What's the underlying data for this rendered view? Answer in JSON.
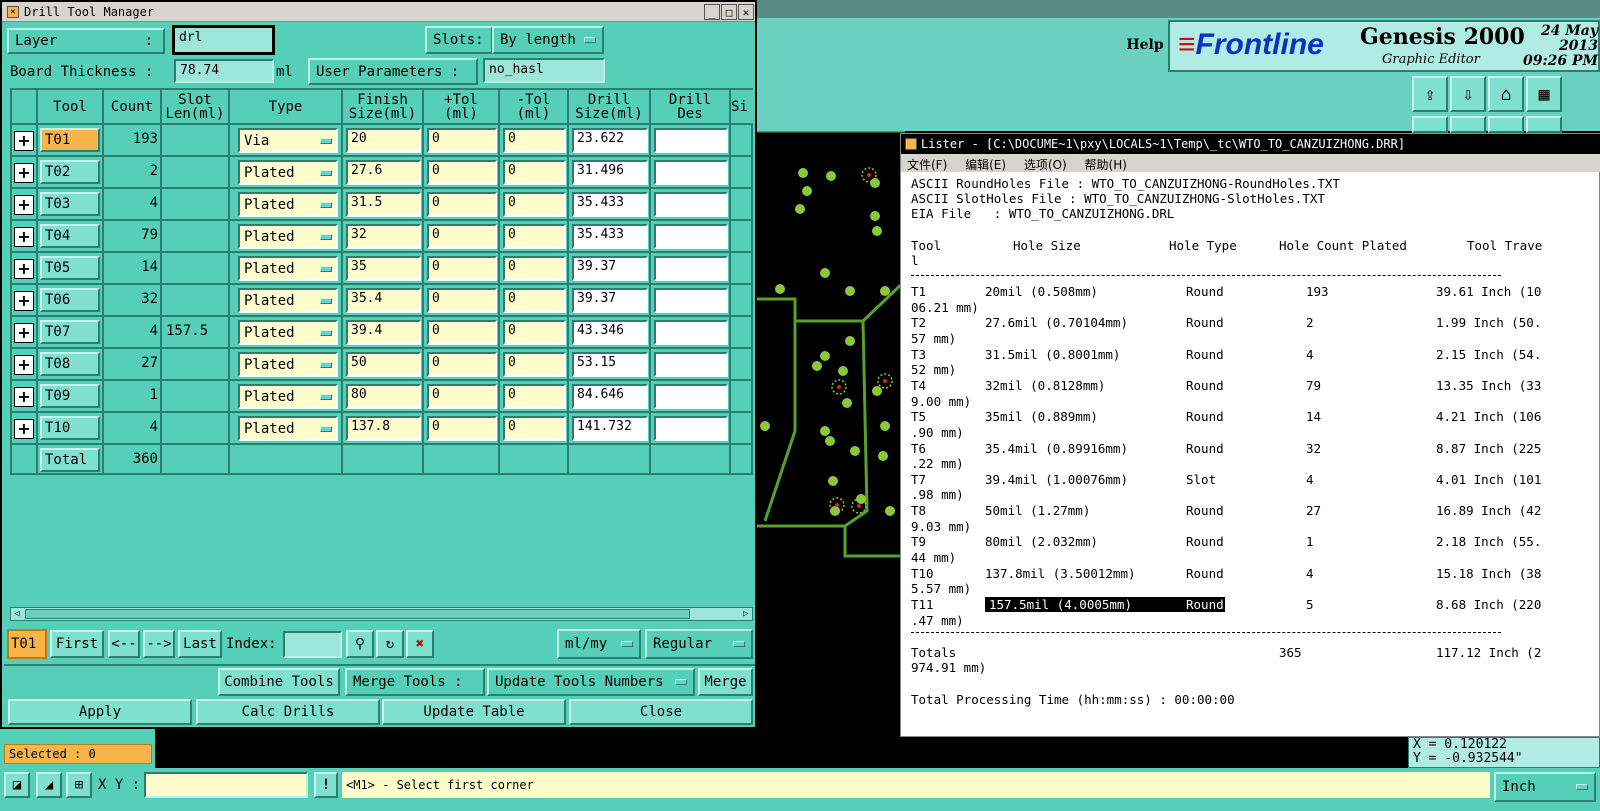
{
  "drill_window": {
    "title": "Drill Tool Manager",
    "layer_label": "Layer",
    "layer_colon": ":",
    "layer_value": "drl",
    "slots_label": "Slots:",
    "slots_value": "By length",
    "board_thickness_label": "Board Thickness :",
    "board_thickness_value": "78.74",
    "board_thickness_unit": "ml",
    "user_params_label": "User Parameters :",
    "user_params_value": "no_hasl"
  },
  "columns": [
    "Tool",
    "Count",
    "Slot\nLen(ml)",
    "Type",
    "Finish\nSize(ml)",
    "+Tol\n(ml)",
    "-Tol\n(ml)",
    "Drill\nSize(ml)",
    "Drill\nDes",
    "Si"
  ],
  "rows": [
    {
      "tool": "T01",
      "count": "193",
      "slot": "",
      "type": "Via",
      "finish": "20",
      "ptol": "0",
      "ntol": "0",
      "drill": "23.622",
      "des": ""
    },
    {
      "tool": "T02",
      "count": "2",
      "slot": "",
      "type": "Plated",
      "finish": "27.6",
      "ptol": "0",
      "ntol": "0",
      "drill": "31.496",
      "des": ""
    },
    {
      "tool": "T03",
      "count": "4",
      "slot": "",
      "type": "Plated",
      "finish": "31.5",
      "ptol": "0",
      "ntol": "0",
      "drill": "35.433",
      "des": ""
    },
    {
      "tool": "T04",
      "count": "79",
      "slot": "",
      "type": "Plated",
      "finish": "32",
      "ptol": "0",
      "ntol": "0",
      "drill": "35.433",
      "des": ""
    },
    {
      "tool": "T05",
      "count": "14",
      "slot": "",
      "type": "Plated",
      "finish": "35",
      "ptol": "0",
      "ntol": "0",
      "drill": "39.37",
      "des": ""
    },
    {
      "tool": "T06",
      "count": "32",
      "slot": "",
      "type": "Plated",
      "finish": "35.4",
      "ptol": "0",
      "ntol": "0",
      "drill": "39.37",
      "des": ""
    },
    {
      "tool": "T07",
      "count": "4",
      "slot": "157.5",
      "type": "Plated",
      "finish": "39.4",
      "ptol": "0",
      "ntol": "0",
      "drill": "43.346",
      "des": ""
    },
    {
      "tool": "T08",
      "count": "27",
      "slot": "",
      "type": "Plated",
      "finish": "50",
      "ptol": "0",
      "ntol": "0",
      "drill": "53.15",
      "des": ""
    },
    {
      "tool": "T09",
      "count": "1",
      "slot": "",
      "type": "Plated",
      "finish": "80",
      "ptol": "0",
      "ntol": "0",
      "drill": "84.646",
      "des": ""
    },
    {
      "tool": "T10",
      "count": "4",
      "slot": "",
      "type": "Plated",
      "finish": "137.8",
      "ptol": "0",
      "ntol": "0",
      "drill": "141.732",
      "des": ""
    }
  ],
  "total": {
    "label": "Total",
    "count": "360"
  },
  "nav": {
    "current": "T01",
    "first": "First",
    "prev": "<--",
    "next": "-->",
    "last": "Last",
    "index_label": "Index:",
    "index_value": "",
    "units": "ml/my",
    "mode": "Regular"
  },
  "actions": {
    "combine": "Combine Tools",
    "merge_label": "Merge Tools :",
    "merge_option": "Update Tools Numbers",
    "merge": "Merge",
    "apply": "Apply",
    "calc": "Calc Drills",
    "update": "Update Table",
    "close": "Close"
  },
  "status": {
    "selected": "Selected : 0",
    "xy_label": "X Y :",
    "prompt": "<M1> - Select first corner",
    "units": "Inch",
    "coord_x": "X = 0.120122",
    "coord_y": "Y = -0.932544\""
  },
  "app": {
    "help": "Help",
    "brand": "Frontline",
    "product": "Genesis 2000",
    "subtitle": "Graphic Editor",
    "date": "24 May 2013",
    "time": "09:26 PM"
  },
  "lister": {
    "title": "Lister - [C:\\DOCUME~1\\pxy\\LOCALS~1\\Temp\\_tc\\WTO_TO_CANZUIZHONG.DRR]",
    "menu": [
      "文件(F)",
      "编辑(E)",
      "选项(O)",
      "帮助(H)"
    ],
    "header_lines": [
      "ASCII RoundHoles File : WTO_TO_CANZUIZHONG-RoundHoles.TXT",
      "ASCII SlotHoles File : WTO_TO_CANZUIZHONG-SlotHoles.TXT",
      "EIA File   : WTO_TO_CANZUIZHONG.DRL"
    ],
    "col_tool": "Tool",
    "col_tool2": "l",
    "col_size": "Hole Size",
    "col_type": "Hole Type",
    "col_count": "Hole Count Plated",
    "col_travel": "Tool Trave",
    "rows": [
      {
        "tool": "T1",
        "size": "20mil (0.508mm)",
        "type": "Round",
        "count": "193",
        "travel": "39.61 Inch (10",
        "cont": "06.21 mm)"
      },
      {
        "tool": "T2",
        "size": "27.6mil (0.70104mm)",
        "type": "Round",
        "count": "2",
        "travel": "1.99 Inch (50.",
        "cont": "57 mm)"
      },
      {
        "tool": "T3",
        "size": "31.5mil (0.8001mm)",
        "type": "Round",
        "count": "4",
        "travel": "2.15 Inch (54.",
        "cont": "52 mm)"
      },
      {
        "tool": "T4",
        "size": "32mil (0.8128mm)",
        "type": "Round",
        "count": "79",
        "travel": "13.35 Inch (33",
        "cont": "9.00 mm)"
      },
      {
        "tool": "T5",
        "size": "35mil (0.889mm)",
        "type": "Round",
        "count": "14",
        "travel": "4.21 Inch (106",
        "cont": ".90 mm)"
      },
      {
        "tool": "T6",
        "size": "35.4mil (0.89916mm)",
        "type": "Round",
        "count": "32",
        "travel": "8.87 Inch (225",
        "cont": ".22 mm)"
      },
      {
        "tool": "T7",
        "size": "39.4mil (1.00076mm)",
        "type": "Slot",
        "count": "4",
        "travel": "4.01 Inch (101",
        "cont": ".98 mm)"
      },
      {
        "tool": "T8",
        "size": "50mil (1.27mm)",
        "type": "Round",
        "count": "27",
        "travel": "16.89 Inch (42",
        "cont": "9.03 mm)"
      },
      {
        "tool": "T9",
        "size": "80mil (2.032mm)",
        "type": "Round",
        "count": "1",
        "travel": "2.18 Inch (55.",
        "cont": "44 mm)"
      },
      {
        "tool": "T10",
        "size": "137.8mil (3.50012mm)",
        "type": "Round",
        "count": "4",
        "travel": "15.18 Inch (38",
        "cont": "5.57 mm)"
      },
      {
        "tool": "T11",
        "size": "157.5mil (4.0005mm)",
        "type": "Round",
        "count": "5",
        "travel": "8.68 Inch (220",
        "cont": ".47 mm)"
      }
    ],
    "totals_label": "Totals",
    "totals_count": "365",
    "totals_travel": "117.12 Inch (2",
    "totals_cont": "974.91 mm)",
    "processing": "Total Processing Time (hh:mm:ss) : 00:00:00"
  }
}
